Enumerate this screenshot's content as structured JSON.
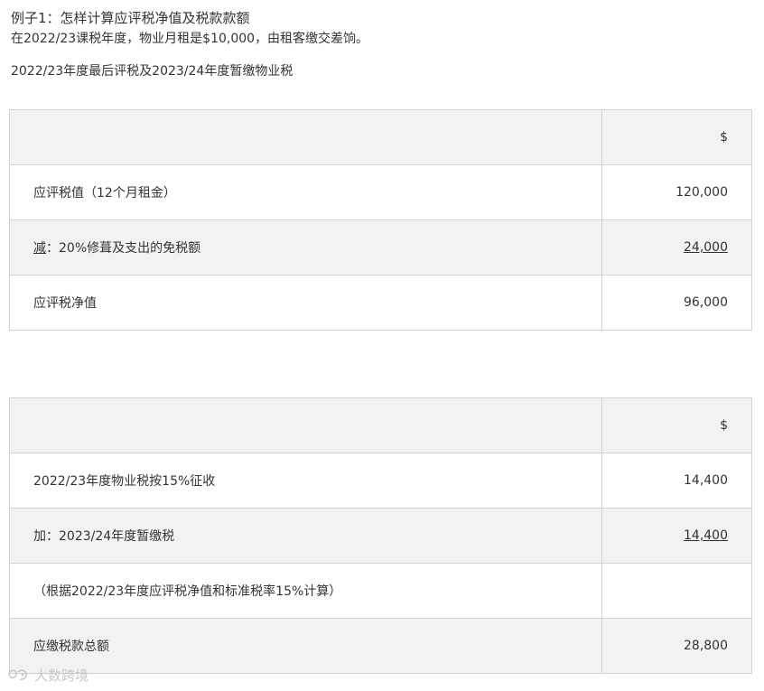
{
  "title": "例子1：怎样计算应评税净值及税款款额",
  "intro": "在2022/23课税年度，物业月租是$10,000，由租客缴交差饷。",
  "subheading": "2022/23年度最后评税及2023/24年度暂缴物业税",
  "table1": {
    "header": {
      "desc": "",
      "amount": "$"
    },
    "rows": [
      {
        "desc": "应评税值（12个月租金）",
        "amount": "120,000"
      },
      {
        "desc_prefix": "减",
        "desc_rest": "：20%修葺及支出的免税额",
        "amount": "24,000"
      },
      {
        "desc": "应评税净值",
        "amount": "96,000"
      }
    ]
  },
  "table2": {
    "header": {
      "desc": "",
      "amount": "$"
    },
    "rows": [
      {
        "desc": "2022/23年度物业税按15%征收",
        "amount": "14,400"
      },
      {
        "desc": "加：2023/24年度暂缴税",
        "amount": "14,400"
      },
      {
        "desc": "（根据2022/23年度应评税净值和标准税率15%计算）",
        "amount": ""
      },
      {
        "desc": "应缴税款总额",
        "amount": "28,800"
      }
    ]
  },
  "watermark": {
    "text": "大数跨境",
    "icon": "watermark-logo-icon",
    "color": "#c8c8c8"
  }
}
